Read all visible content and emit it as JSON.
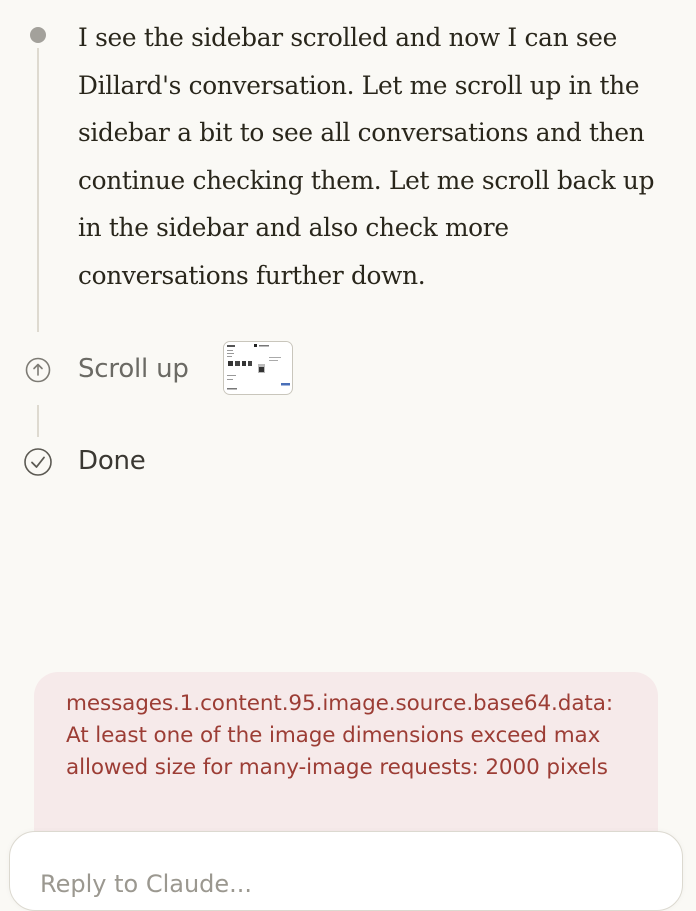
{
  "thought": {
    "text": "I see the sidebar scrolled and now I can see Dillard's conversation. Let me scroll up in the sidebar a bit to see all conversations and then continue checking them. Let me scroll back up in the sidebar and also check more conversations further down."
  },
  "steps": [
    {
      "label": "Scroll up",
      "icon": "arrow-up-circle-icon"
    },
    {
      "label": "Done",
      "icon": "check-circle-icon"
    }
  ],
  "error": {
    "message": "messages.1.content.95.image.source.base64.data: At least one of the image dimensions exceed max allowed size for many-image requests: 2000 pixels"
  },
  "composer": {
    "placeholder": "Reply to Claude..."
  },
  "colors": {
    "background": "#faf9f5",
    "error_background": "#f6eaea",
    "error_text": "#9c3d35",
    "body_text": "#29261b",
    "timeline": "#dedad0"
  }
}
